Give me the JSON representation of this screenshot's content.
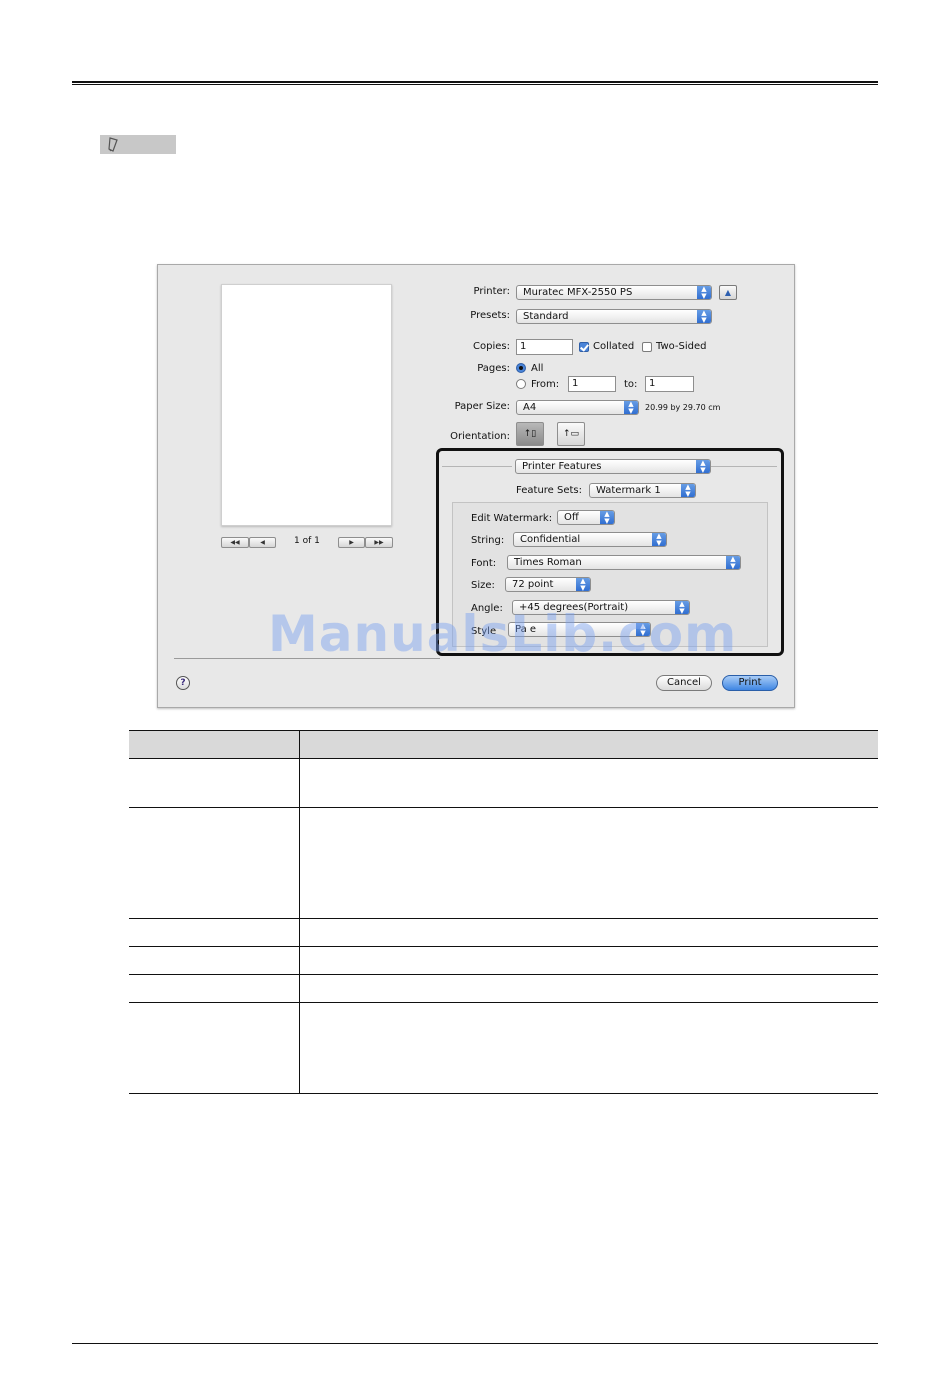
{
  "dialog": {
    "printer": {
      "label": "Printer:",
      "value": "Muratec MFX-2550 PS",
      "expand_icon": "triangle-up-icon"
    },
    "presets": {
      "label": "Presets:",
      "value": "Standard"
    },
    "copies": {
      "label": "Copies:",
      "value": "1",
      "collated_label": "Collated",
      "collated": true,
      "two_sided_label": "Two-Sided",
      "two_sided": false
    },
    "pages": {
      "label": "Pages:",
      "all_label": "All",
      "from_label": "From:",
      "from_value": "1",
      "to_label": "to:",
      "to_value": "1",
      "selected": "All"
    },
    "paper_size": {
      "label": "Paper Size:",
      "value": "A4",
      "dimensions": "20.99 by 29.70 cm"
    },
    "orientation": {
      "label": "Orientation:",
      "options": [
        "portrait-icon",
        "landscape-icon"
      ],
      "selected": "portrait"
    },
    "preview": {
      "page_indicator": "1 of 1",
      "first_label": "◀◀",
      "prev_label": "◀",
      "next_label": "▶",
      "last_label": "▶▶"
    },
    "section_popup": "Printer Features",
    "feature_sets": {
      "label": "Feature Sets:",
      "value": "Watermark 1"
    },
    "edit_watermark": {
      "label": "Edit Watermark:",
      "value": "Off"
    },
    "string": {
      "label": "String:",
      "value": "Confidential"
    },
    "font": {
      "label": "Font:",
      "value": "Times Roman"
    },
    "size": {
      "label": "Size:",
      "value": "72 point"
    },
    "angle": {
      "label": "Angle:",
      "value": "+45 degrees(Portrait)"
    },
    "style": {
      "label": "Style",
      "value": "Pa  e"
    },
    "help_icon": "?",
    "cancel_label": "Cancel",
    "print_label": "Print",
    "accent_color": "#3f86e3"
  },
  "overlay_watermark": "ManualsLib.com",
  "table": {
    "header": [
      "",
      ""
    ],
    "rows": [
      [
        "",
        ""
      ],
      [
        "",
        ""
      ],
      [
        "",
        ""
      ],
      [
        "",
        ""
      ],
      [
        "",
        ""
      ],
      [
        "",
        ""
      ]
    ]
  }
}
